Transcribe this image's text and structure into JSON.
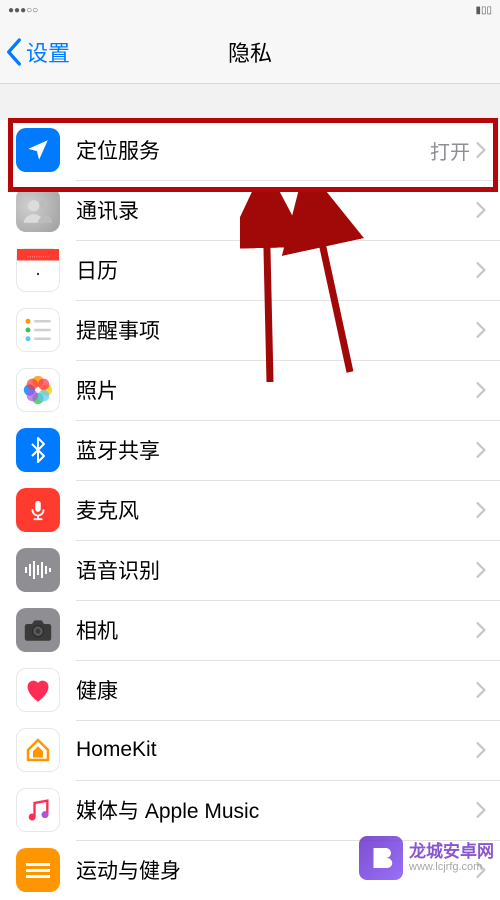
{
  "nav": {
    "back_label": "设置",
    "title": "隐私"
  },
  "rows": [
    {
      "id": "location",
      "label": "定位服务",
      "value": "打开",
      "icon_name": "location-icon"
    },
    {
      "id": "contacts",
      "label": "通讯录",
      "value": "",
      "icon_name": "contacts-icon"
    },
    {
      "id": "calendar",
      "label": "日历",
      "value": "",
      "icon_name": "calendar-icon"
    },
    {
      "id": "reminders",
      "label": "提醒事项",
      "value": "",
      "icon_name": "reminders-icon"
    },
    {
      "id": "photos",
      "label": "照片",
      "value": "",
      "icon_name": "photos-icon"
    },
    {
      "id": "bluetooth",
      "label": "蓝牙共享",
      "value": "",
      "icon_name": "bluetooth-icon"
    },
    {
      "id": "mic",
      "label": "麦克风",
      "value": "",
      "icon_name": "microphone-icon"
    },
    {
      "id": "speech",
      "label": "语音识别",
      "value": "",
      "icon_name": "speech-icon"
    },
    {
      "id": "camera",
      "label": "相机",
      "value": "",
      "icon_name": "camera-icon"
    },
    {
      "id": "health",
      "label": "健康",
      "value": "",
      "icon_name": "health-icon"
    },
    {
      "id": "homekit",
      "label": "HomeKit",
      "value": "",
      "icon_name": "homekit-icon"
    },
    {
      "id": "music",
      "label": "媒体与 Apple Music",
      "value": "",
      "icon_name": "music-icon"
    },
    {
      "id": "motion",
      "label": "运动与健身",
      "value": "",
      "icon_name": "motion-icon"
    }
  ],
  "watermark": {
    "main": "龙城安卓网",
    "sub": "www.lcjrfg.com"
  }
}
